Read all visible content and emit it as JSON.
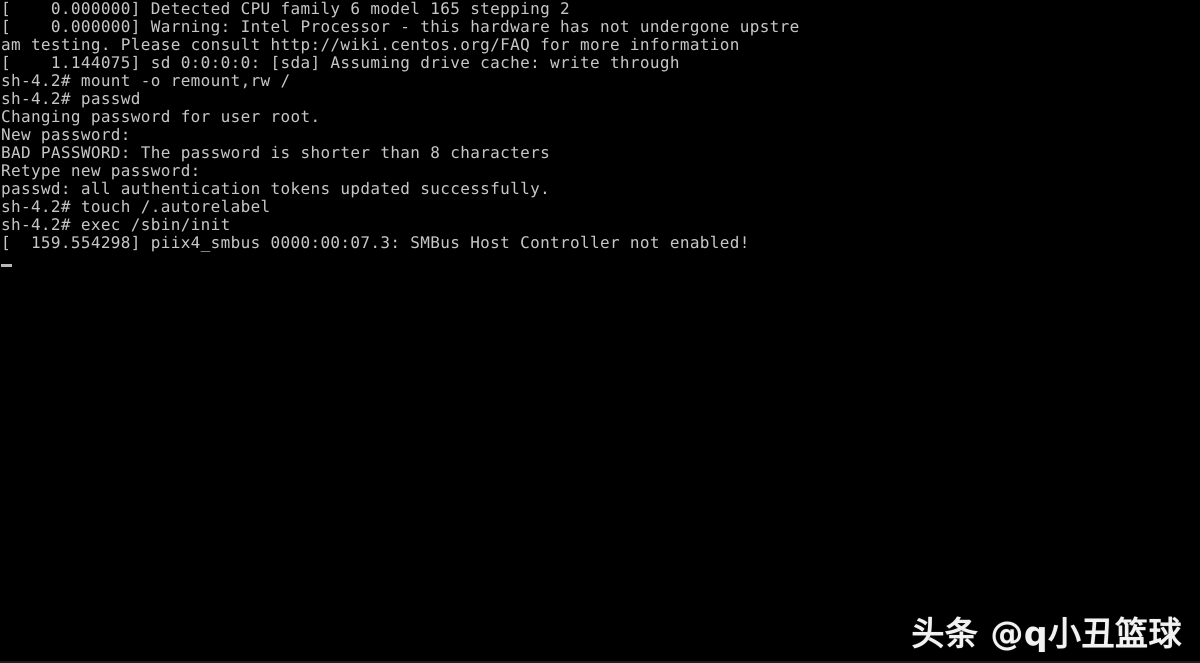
{
  "screen": {
    "background_color": "#000000",
    "text_color": "#c6c6c6",
    "cursor_color": "#b8b8b8",
    "bottom_edge_color": "#1d1d1d",
    "watermark_color": "#f2f2f2"
  },
  "terminal": {
    "shell_prompt": "sh-4.2#",
    "lines": [
      "[    0.000000] Detected CPU family 6 model 165 stepping 2",
      "[    0.000000] Warning: Intel Processor - this hardware has not undergone upstre",
      "am testing. Please consult http://wiki.centos.org/FAQ for more information",
      "[    1.144075] sd 0:0:0:0: [sda] Assuming drive cache: write through",
      "sh-4.2# mount -o remount,rw /",
      "sh-4.2# passwd",
      "Changing password for user root.",
      "New password:",
      "BAD PASSWORD: The password is shorter than 8 characters",
      "Retype new password:",
      "passwd: all authentication tokens updated successfully.",
      "sh-4.2# touch /.autorelabel",
      "sh-4.2# exec /sbin/init",
      "[  159.554298] piix4_smbus 0000:00:07.3: SMBus Host Controller not enabled!"
    ],
    "cursor": "_"
  },
  "watermark": {
    "text": "头条 @q小丑篮球"
  }
}
